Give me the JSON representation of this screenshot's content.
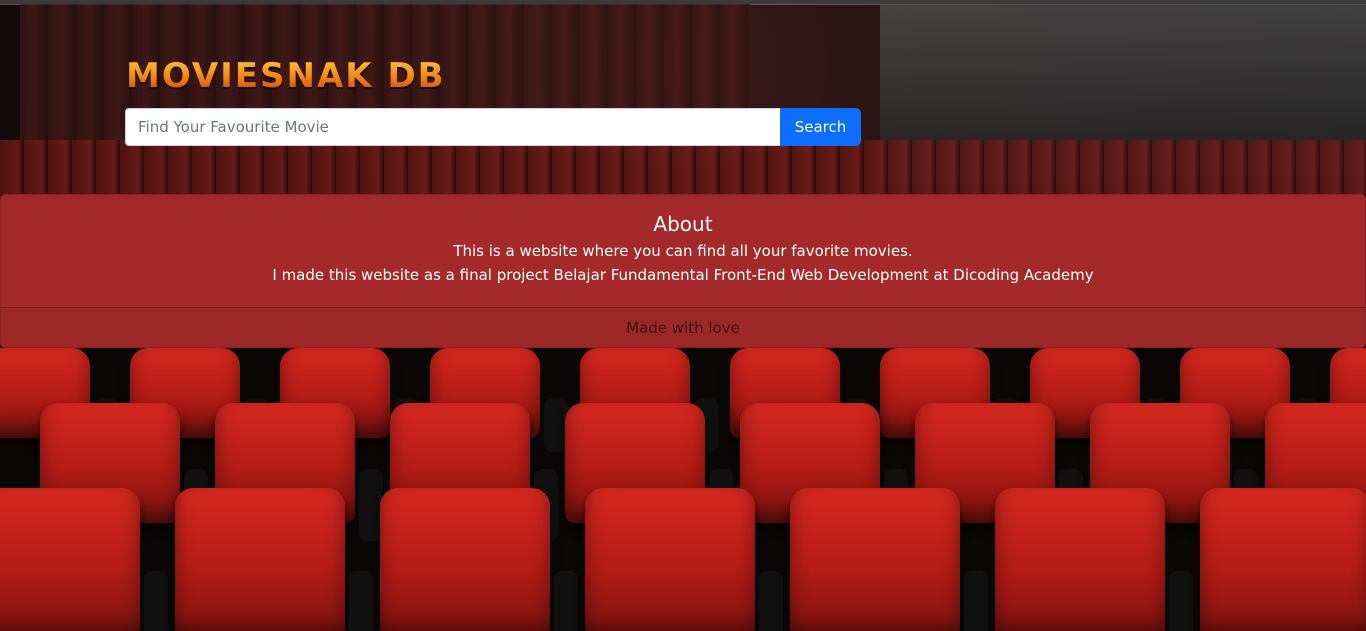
{
  "header": {
    "brand": "MOVIESNAK DB"
  },
  "search": {
    "placeholder": "Find Your Favourite Movie",
    "value": "",
    "button_label": "Search"
  },
  "about": {
    "title": "About",
    "line1": "This is a website where you can find all your favorite movies.",
    "line2": "I made this website as a final project Belajar Fundamental Front-End Web Development at Dicoding Academy",
    "footer": "Made with love"
  },
  "colors": {
    "brand_gradient_top": "#ffcf3a",
    "brand_gradient_bottom": "#d4370d",
    "search_button": "#0d6efd",
    "about_card": "#a4292a",
    "seat_red": "#d6281f"
  },
  "background": {
    "icon": "cinema-seats-image"
  }
}
